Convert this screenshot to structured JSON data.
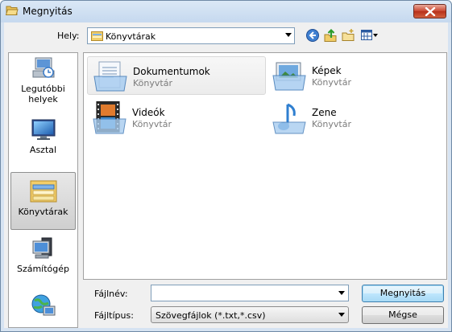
{
  "window": {
    "title": "Megnyitás"
  },
  "toolbar": {
    "location_label": "Hely:",
    "location_value": "Könyvtárak"
  },
  "places": [
    {
      "label": "Legutóbbi helyek",
      "icon": "recent-places-icon"
    },
    {
      "label": "Asztal",
      "icon": "desktop-icon"
    },
    {
      "label": "Könyvtárak",
      "icon": "libraries-icon",
      "selected": true
    },
    {
      "label": "Számítógép",
      "icon": "computer-icon"
    },
    {
      "label": "",
      "icon": "network-icon"
    }
  ],
  "files": [
    {
      "name": "Dokumentumok",
      "type": "Könyvtár",
      "icon": "documents-library-icon"
    },
    {
      "name": "Képek",
      "type": "Könyvtár",
      "icon": "pictures-library-icon"
    },
    {
      "name": "Videók",
      "type": "Könyvtár",
      "icon": "videos-library-icon"
    },
    {
      "name": "Zene",
      "type": "Könyvtár",
      "icon": "music-library-icon"
    }
  ],
  "footer": {
    "filename_label": "Fájlnév:",
    "filename_value": "",
    "filetype_label": "Fájltípus:",
    "filetype_value": "Szövegfájlok (*.txt,*.csv)",
    "open_label": "Megnyitás",
    "cancel_label": "Mégse"
  }
}
